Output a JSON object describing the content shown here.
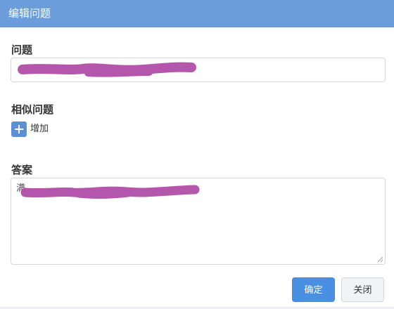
{
  "dialog": {
    "title": "编辑问题"
  },
  "question": {
    "label": "问题",
    "value_redacted": true
  },
  "similar": {
    "label": "相似问题",
    "add_label": "增加",
    "add_icon": "plus-icon"
  },
  "answer": {
    "label": "答案",
    "value_visible_fragment": "满",
    "value_redacted": true
  },
  "buttons": {
    "ok_label": "确定",
    "close_label": "关闭"
  },
  "colors": {
    "titlebar": "#6b9ddb",
    "primary": "#4a90e2",
    "redaction": "#b04fa8"
  }
}
